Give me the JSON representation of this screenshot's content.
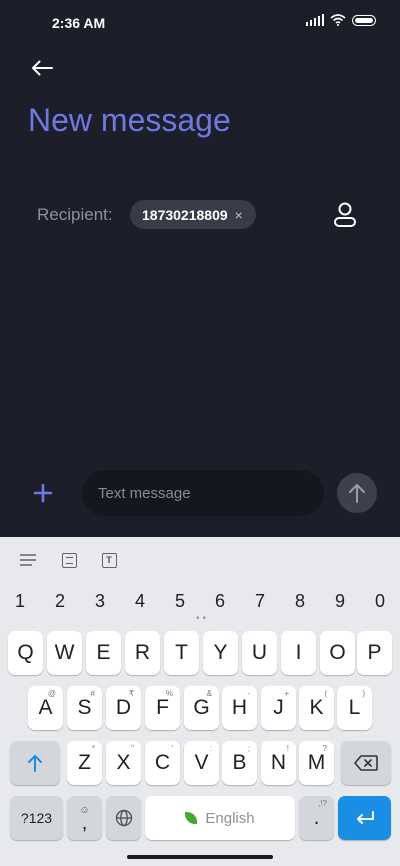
{
  "status_bar": {
    "time": "2:36 AM"
  },
  "header": {
    "title": "New message"
  },
  "recipient": {
    "label": "Recipient:",
    "chip_value": "18730218809",
    "chip_close": "×"
  },
  "composer": {
    "placeholder": "Text message"
  },
  "keyboard": {
    "numbers": [
      "1",
      "2",
      "3",
      "4",
      "5",
      "6",
      "7",
      "8",
      "9",
      "0"
    ],
    "row1": [
      "Q",
      "W",
      "E",
      "R",
      "T",
      "Y",
      "U",
      "I",
      "O",
      "P"
    ],
    "row2": [
      "A",
      "S",
      "D",
      "F",
      "G",
      "H",
      "J",
      "K",
      "L"
    ],
    "row2_sup": [
      "@",
      "#",
      "₹",
      "%",
      "&",
      "-",
      "+",
      "(",
      ")"
    ],
    "row3": [
      "Z",
      "X",
      "C",
      "V",
      "B",
      "N",
      "M"
    ],
    "row3_sup": [
      "*",
      "\"",
      "'",
      ":",
      ";",
      "!",
      "?"
    ],
    "symbols_label": "?123",
    "comma_label": ",",
    "space_label": "English",
    "period_label": ".",
    "period_sup": ",!?",
    "toolbar": {
      "text_tool_glyph": "T"
    }
  },
  "colors": {
    "accent": "#6d79e0",
    "enter_key": "#1a8de5",
    "background": "#1c1f2a"
  }
}
